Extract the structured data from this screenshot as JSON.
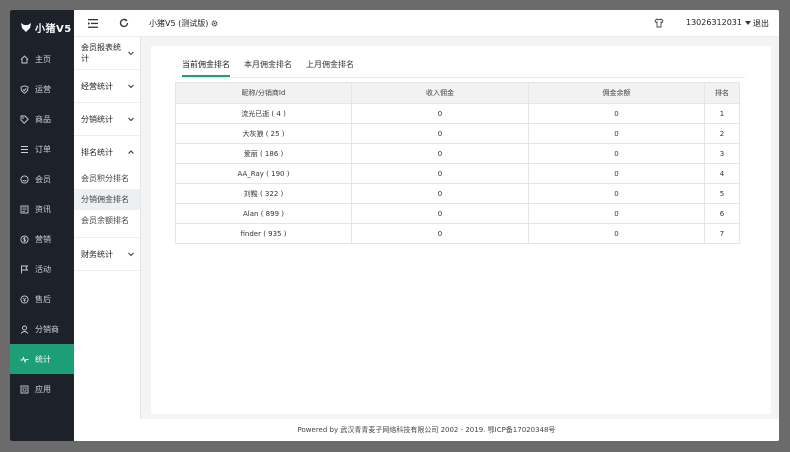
{
  "app": {
    "logo_text": "小猪V5",
    "title": "小猪V5 (测试版)",
    "account": "13026312031",
    "logout": "退出"
  },
  "sidebar": {
    "items": [
      {
        "label": "主页",
        "icon": "home-icon"
      },
      {
        "label": "运营",
        "icon": "shield-icon"
      },
      {
        "label": "商品",
        "icon": "tag-icon"
      },
      {
        "label": "订单",
        "icon": "list-icon"
      },
      {
        "label": "会员",
        "icon": "smile-icon"
      },
      {
        "label": "资讯",
        "icon": "news-icon"
      },
      {
        "label": "营销",
        "icon": "dollar-icon"
      },
      {
        "label": "活动",
        "icon": "flag-icon"
      },
      {
        "label": "售后",
        "icon": "aftersale-icon"
      },
      {
        "label": "分销商",
        "icon": "user-icon"
      },
      {
        "label": "统计",
        "icon": "pulse-icon"
      },
      {
        "label": "应用",
        "icon": "app-icon"
      }
    ]
  },
  "submenu": {
    "groups": [
      {
        "label": "会员报表统计"
      },
      {
        "label": "经营统计"
      },
      {
        "label": "分销统计"
      },
      {
        "label": "排名统计",
        "items": [
          "会员积分排名",
          "分销佣金排名",
          "会员余额排名"
        ]
      },
      {
        "label": "财务统计"
      }
    ]
  },
  "tabs": [
    "当前佣金排名",
    "本月佣金排名",
    "上月佣金排名"
  ],
  "table": {
    "headers": [
      "昵称/分销商Id",
      "收入佣金",
      "佣金余额",
      "排名"
    ],
    "rows": [
      [
        "流光已逝 ( 4 )",
        "0",
        "0",
        "1"
      ],
      [
        "大灰狼 ( 25 )",
        "0",
        "0",
        "2"
      ],
      [
        "爱丽 ( 186 )",
        "0",
        "0",
        "3"
      ],
      [
        "AA_Ray ( 190 )",
        "0",
        "0",
        "4"
      ],
      [
        "刘黢 ( 322 )",
        "0",
        "0",
        "5"
      ],
      [
        "Alan ( 899 )",
        "0",
        "0",
        "6"
      ],
      [
        "finder ( 935 )",
        "0",
        "0",
        "7"
      ]
    ]
  },
  "footer": "Powered by 武汉青青麦子网络科技有限公司 2002 - 2019. 鄂ICP备17020348号"
}
